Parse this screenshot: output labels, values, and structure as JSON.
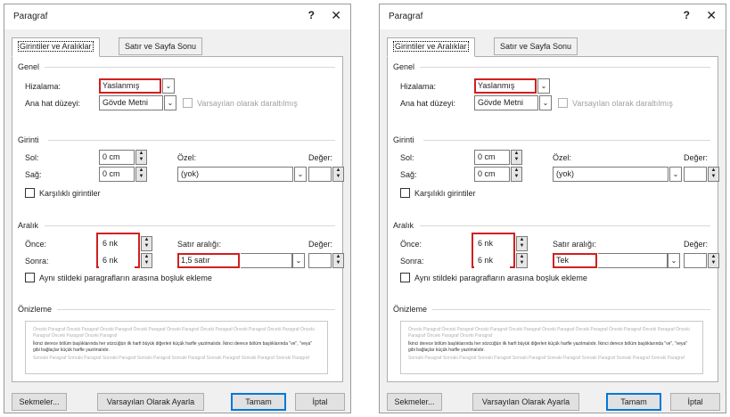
{
  "dialog": {
    "title": "Paragraf",
    "help": "?",
    "close": "✕",
    "tabs": [
      "Girintiler ve Aralıklar",
      "Satır ve Sayfa Sonu"
    ],
    "general": {
      "heading": "Genel",
      "alignment_label": "Hizalama:",
      "alignment_value": "Yaslanmış",
      "outline_label": "Ana hat düzeyi:",
      "outline_value": "Gövde Metni",
      "collapsed_label": "Varsayılan olarak daraltılmış"
    },
    "indent": {
      "heading": "Girinti",
      "left_label": "Sol:",
      "left_value": "0 cm",
      "right_label": "Sağ:",
      "right_value": "0 cm",
      "special_label": "Özel:",
      "special_value": "(yok)",
      "by_label": "Değer:",
      "mirror_label": "Karşılıklı girintiler"
    },
    "spacing": {
      "heading": "Aralık",
      "before_label": "Önce:",
      "before_value": "6 nk",
      "after_label": "Sonra:",
      "after_value": "6 nk",
      "line_label": "Satır aralığı:",
      "at_label": "Değer:",
      "dont_add_label": "Aynı stildeki paragrafların arasına boşluk ekleme"
    },
    "preview": {
      "heading": "Önizleme",
      "prev_text": "Önceki Paragraf Önceki Paragraf Önceki Paragraf Önceki Paragraf Önceki Paragraf Önceki Paragraf Önceki Paragraf Önceki Paragraf Önceki Paragraf Önceki Paragraf Önceki Paragraf",
      "sample_text": "İkinci derece bölüm başlıklarında her sözcüğün ilk harfi büyük diğerleri küçük harfle yazılmalıdır. İkinci derece bölüm başlıklarında \"ve\", \"veya\" gibi bağlaçlar küçük harfle yazılmalıdır.",
      "next_text": "Sonraki Paragraf Sonraki Paragraf Sonraki Paragraf Sonraki Paragraf Sonraki Paragraf Sonraki Paragraf Sonraki Paragraf Sonraki Paragraf"
    },
    "buttons": {
      "tabs": "Sekmeler...",
      "default": "Varsayılan Olarak Ayarla",
      "ok": "Tamam",
      "cancel": "İptal"
    }
  },
  "left_line_spacing": "1,5 satır",
  "right_line_spacing": "Tek",
  "colors": {
    "highlight": "#d02020",
    "accent": "#0078d7"
  }
}
